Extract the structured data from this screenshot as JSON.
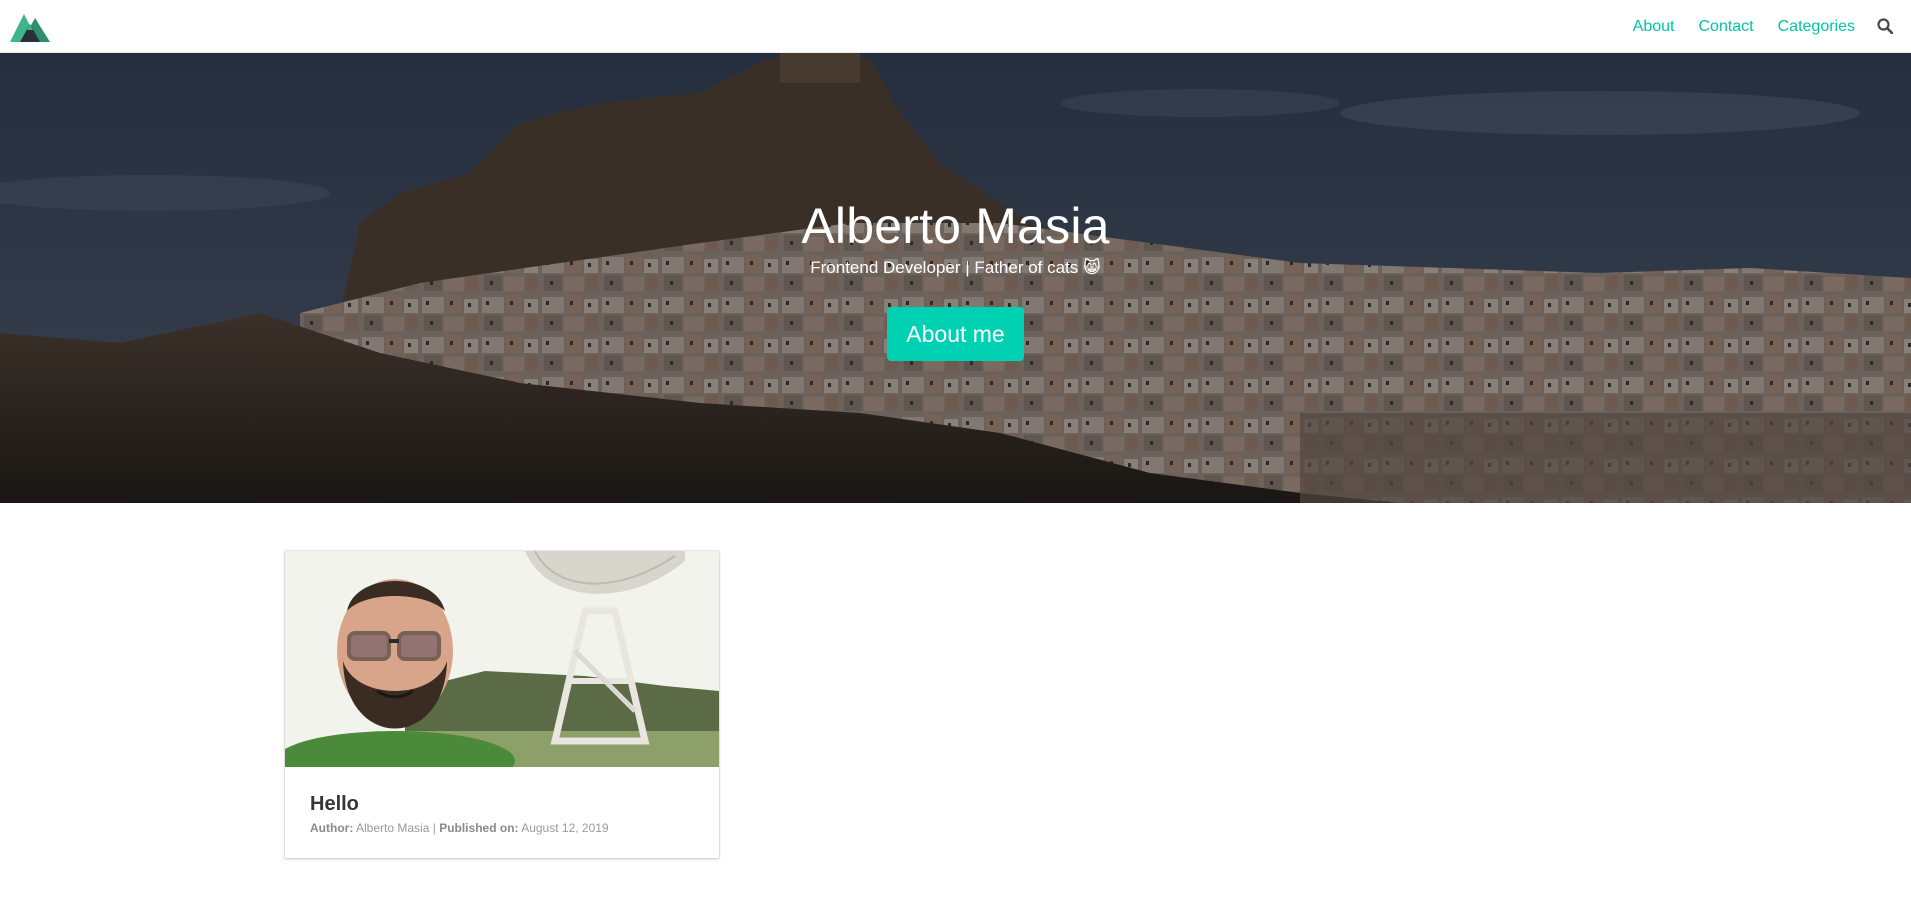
{
  "nav": {
    "logo_icon": "mountain-logo",
    "links": [
      {
        "label": "About"
      },
      {
        "label": "Contact"
      },
      {
        "label": "Categories"
      }
    ],
    "search_icon": "search-icon",
    "accent_color": "#00c4a7"
  },
  "hero": {
    "title": "Alberto Masia",
    "subtitle": "Frontend Developer | Father of cats",
    "subtitle_emoji": "😸",
    "button_label": "About me",
    "button_color": "#00d1b2"
  },
  "posts": [
    {
      "title": "Hello",
      "author_label": "Author:",
      "author": "Alberto Masia",
      "separator": "|",
      "published_label": "Published on:",
      "date": "August 12, 2019"
    }
  ]
}
